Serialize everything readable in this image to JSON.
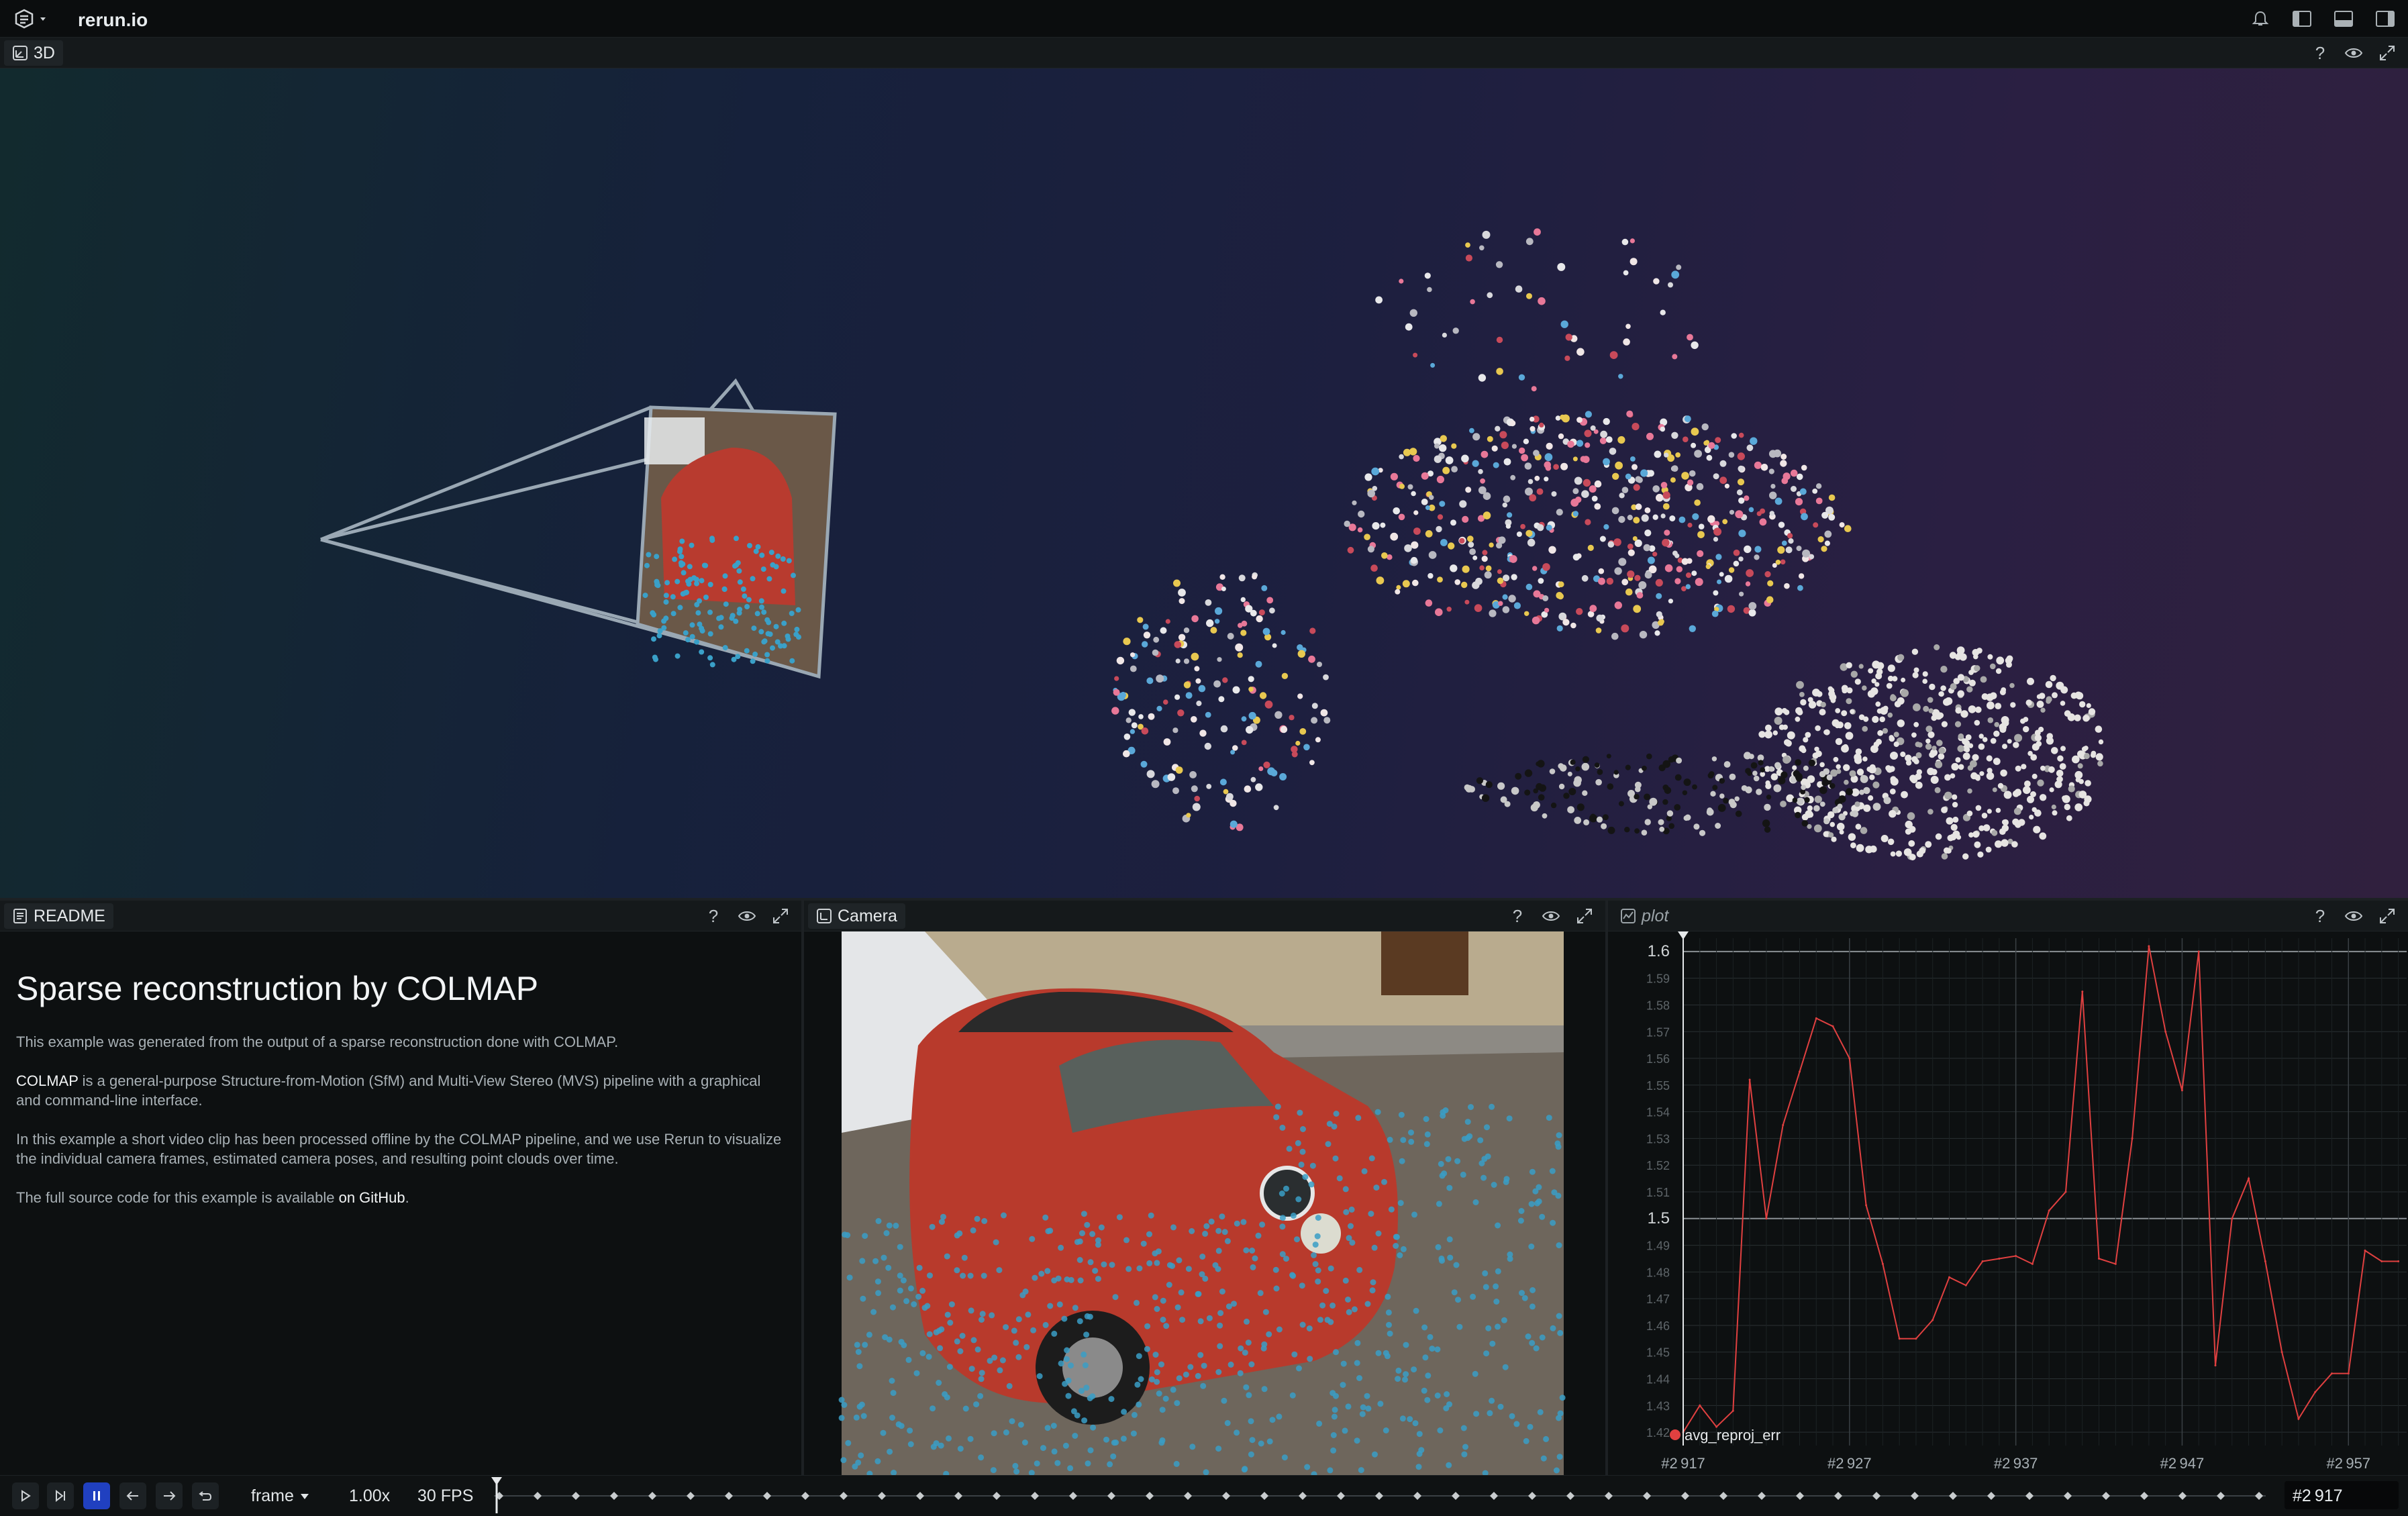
{
  "app": {
    "title": "rerun.io"
  },
  "view3d": {
    "tab_label": "3D"
  },
  "readme": {
    "tab_label": "README",
    "heading": "Sparse reconstruction by COLMAP",
    "p1": "This example was generated from the output of a sparse reconstruction done with COLMAP.",
    "p2_strong": "COLMAP",
    "p2_rest": " is a general-purpose Structure-from-Motion (SfM) and Multi-View Stereo (MVS) pipeline with a graphical and command-line interface.",
    "p3": "In this example a short video clip has been processed offline by the COLMAP pipeline, and we use Rerun to visualize the individual camera frames, estimated camera poses, and resulting point clouds over time.",
    "p4_pre": "The full source code for this example is available ",
    "p4_link": "on GitHub",
    "p4_post": "."
  },
  "camera": {
    "tab_label": "Camera"
  },
  "plot": {
    "tab_label": "plot"
  },
  "panel_buttons": {
    "help": "?"
  },
  "chart_data": {
    "type": "line",
    "series": [
      {
        "name": "avg_reproj_err",
        "color": "#e04040",
        "x": [
          2917,
          2918,
          2919,
          2920,
          2921,
          2922,
          2923,
          2924,
          2925,
          2926,
          2927,
          2928,
          2929,
          2930,
          2931,
          2932,
          2933,
          2934,
          2935,
          2936,
          2937,
          2938,
          2939,
          2940,
          2941,
          2942,
          2943,
          2944,
          2945,
          2946,
          2947,
          2948,
          2949,
          2950,
          2951,
          2952,
          2953,
          2954,
          2955,
          2956,
          2957,
          2958,
          2959,
          2960
        ],
        "y": [
          1.42,
          1.43,
          1.422,
          1.428,
          1.552,
          1.5,
          1.535,
          1.555,
          1.575,
          1.572,
          1.56,
          1.505,
          1.483,
          1.455,
          1.455,
          1.462,
          1.478,
          1.475,
          1.484,
          1.485,
          1.486,
          1.483,
          1.503,
          1.51,
          1.585,
          1.485,
          1.483,
          1.53,
          1.602,
          1.57,
          1.548,
          1.6,
          1.445,
          1.5,
          1.515,
          1.484,
          1.45,
          1.425,
          1.435,
          1.442,
          1.442,
          1.488,
          1.484,
          1.484
        ]
      }
    ],
    "ylim": [
      1.415,
      1.605
    ],
    "y_ticks": [
      "1.6",
      "1.59",
      "1.58",
      "1.57",
      "1.56",
      "1.55",
      "1.54",
      "1.53",
      "1.52",
      "1.51",
      "1.5",
      "1.49",
      "1.48",
      "1.47",
      "1.46",
      "1.45",
      "1.44",
      "1.43",
      "1.42"
    ],
    "x_ticks": [
      "#2 917",
      "#2 927",
      "#2 937",
      "#2 947",
      "#2 957"
    ],
    "legend": "bottom-left",
    "grid": true
  },
  "timeline": {
    "timeline_name": "frame",
    "speed": "1.00x",
    "fps": "30 FPS",
    "current": "#2 917"
  }
}
